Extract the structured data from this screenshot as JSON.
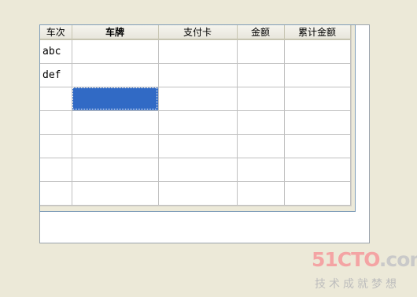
{
  "grid": {
    "columns": [
      {
        "label": "车次",
        "bold": false
      },
      {
        "label": "车牌",
        "bold": true
      },
      {
        "label": "支付卡",
        "bold": false
      },
      {
        "label": "金额",
        "bold": false
      },
      {
        "label": "累计金额",
        "bold": false
      }
    ],
    "rows": [
      [
        "abc",
        "",
        "",
        "",
        ""
      ],
      [
        "def",
        "",
        "",
        "",
        ""
      ],
      [
        "",
        "",
        "",
        "",
        ""
      ],
      [
        "",
        "",
        "",
        "",
        ""
      ],
      [
        "",
        "",
        "",
        "",
        ""
      ],
      [
        "",
        "",
        "",
        "",
        ""
      ],
      [
        "",
        "",
        "",
        "",
        ""
      ]
    ],
    "selected_cell": {
      "row": 2,
      "col": 1
    },
    "selection_color": "#316ac5"
  },
  "watermark": {
    "brand_number": "51CTO",
    "brand_suffix": ".com",
    "slogan": "技术成就梦想"
  }
}
